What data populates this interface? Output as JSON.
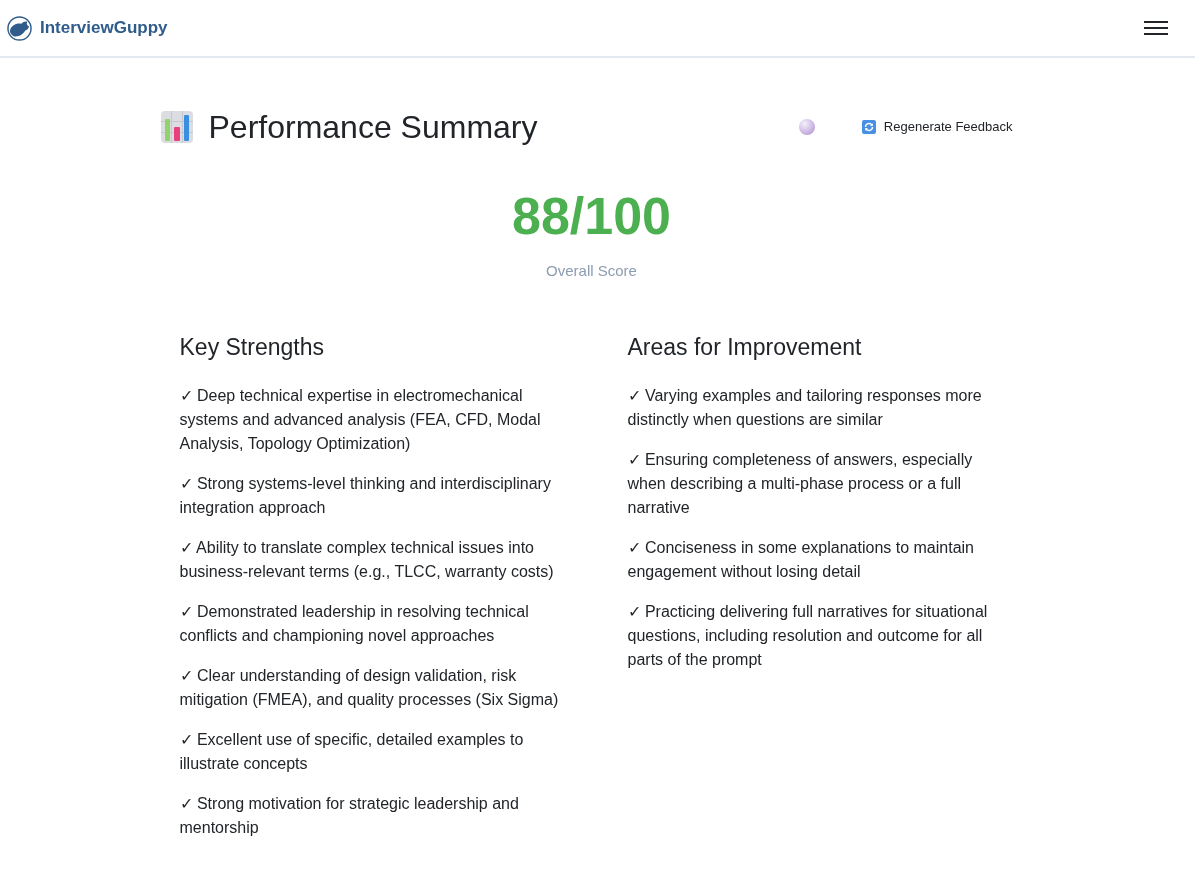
{
  "header": {
    "brand": "InterviewGuppy"
  },
  "summary": {
    "title": "Performance Summary",
    "action": "Regenerate Feedback",
    "score": "88/100",
    "score_label": "Overall Score"
  },
  "sections": [
    {
      "heading": "Key Strengths",
      "items": [
        "✓ Deep technical expertise in electromechanical systems and advanced analysis (FEA, CFD, Modal Analysis, Topology Optimization)",
        "✓ Strong systems-level thinking and interdisciplinary integration approach",
        "✓ Ability to translate complex technical issues into business-relevant terms (e.g., TLCC, warranty costs)",
        "✓ Demonstrated leadership in resolving technical conflicts and championing novel approaches",
        "✓ Clear understanding of design validation, risk mitigation (FMEA), and quality processes (Six Sigma)",
        "✓ Excellent use of specific, detailed examples to illustrate concepts",
        "✓ Strong motivation for strategic leadership and mentorship"
      ]
    },
    {
      "heading": "Areas for Improvement",
      "items": [
        "✓ Varying examples and tailoring responses more distinctly when questions are similar",
        "✓ Ensuring completeness of answers, especially when describing a multi-phase process or a full narrative",
        "✓ Conciseness in some explanations to maintain engagement without losing detail",
        "✓ Practicing delivering full narratives for situational questions, including resolution and outcome for all parts of the prompt"
      ]
    }
  ]
}
